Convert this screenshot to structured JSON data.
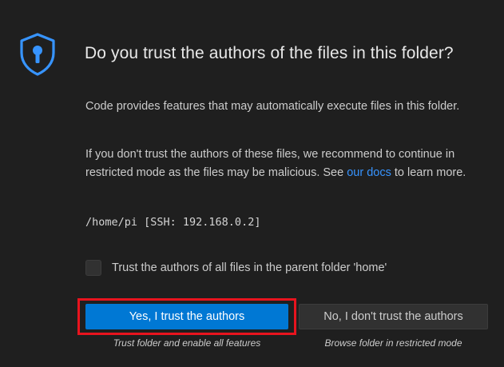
{
  "dialog": {
    "icon": "shield-lock-icon",
    "title": "Do you trust the authors of the files in this folder?",
    "paragraph1": "Code provides features that may automatically execute files in this folder.",
    "paragraph2_before": "If you don't trust the authors of these files, we recommend to continue in restricted mode as the files may be malicious. See ",
    "paragraph2_link": "our docs",
    "paragraph2_after": " to learn more.",
    "folder_path": "/home/pi [SSH: 192.168.0.2]",
    "checkbox": {
      "label": "Trust the authors of all files in the parent folder 'home'",
      "checked": false
    },
    "buttons": {
      "trust_label": "Yes, I trust the authors",
      "trust_caption": "Trust folder and enable all features",
      "distrust_label": "No, I don't trust the authors",
      "distrust_caption": "Browse folder in restricted mode"
    }
  },
  "colors": {
    "background": "#1f1f1f",
    "accent": "#0078d4",
    "link": "#3794ff",
    "highlight": "#e8141e"
  }
}
